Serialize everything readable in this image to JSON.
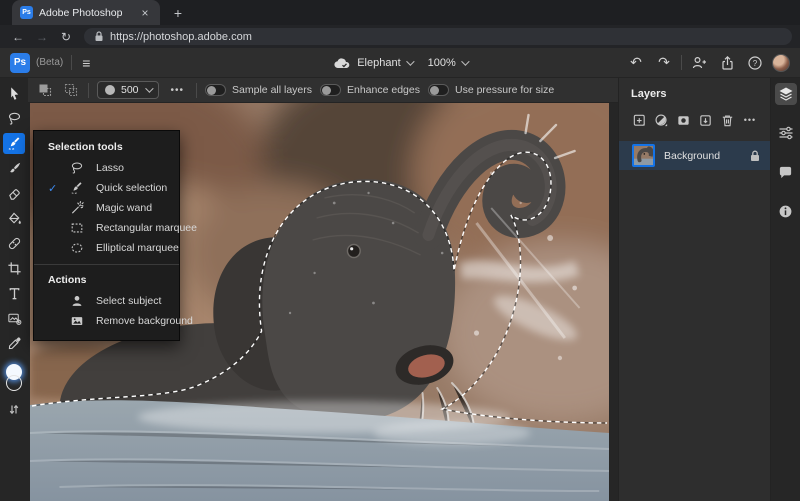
{
  "browser": {
    "tab_title": "Adobe Photoshop",
    "url": "https://photoshop.adobe.com"
  },
  "icons": {
    "close": "×",
    "new_tab": "+",
    "back": "←",
    "forward": "→",
    "reload": "↻",
    "hamburger": "≡",
    "undo": "↶",
    "redo": "↷",
    "help": "?",
    "check": "✓",
    "more_dots": "•••",
    "logo": "Ps",
    "favicon": "Ps"
  },
  "header": {
    "beta_label": "(Beta)",
    "doc_name": "Elephant",
    "zoom_level": "100%"
  },
  "options": {
    "brush_size": "500",
    "toggles": [
      {
        "label": "Sample all layers",
        "state": "off"
      },
      {
        "label": "Enhance edges",
        "state": "off"
      },
      {
        "label": "Use pressure for size",
        "state": "off"
      }
    ]
  },
  "toolbar": {
    "tools": [
      "move",
      "lasso",
      "quick-selection",
      "brush",
      "eraser",
      "fill-bucket",
      "healing-brush",
      "crop",
      "type",
      "image-adjust",
      "eyedropper"
    ],
    "active_tool": "quick-selection"
  },
  "menu": {
    "sections": [
      {
        "title": "Selection tools",
        "items": [
          {
            "label": "Lasso",
            "icon": "lasso-icon",
            "checked": false
          },
          {
            "label": "Quick selection",
            "icon": "quick-selection-icon",
            "checked": true
          },
          {
            "label": "Magic wand",
            "icon": "magic-wand-icon",
            "checked": false
          },
          {
            "label": "Rectangular marquee",
            "icon": "rectangular-marquee-icon",
            "checked": false
          },
          {
            "label": "Elliptical marquee",
            "icon": "elliptical-marquee-icon",
            "checked": false
          }
        ]
      },
      {
        "title": "Actions",
        "items": [
          {
            "label": "Select subject",
            "icon": "select-subject-icon",
            "checked": false
          },
          {
            "label": "Remove background",
            "icon": "remove-background-icon",
            "checked": false
          }
        ]
      }
    ]
  },
  "layers": {
    "title": "Layers",
    "rows": [
      {
        "name": "Background",
        "locked": true,
        "selected": true
      }
    ]
  },
  "colors": {
    "accent_blue": "#1473e6",
    "logo_blue": "#2b7de9",
    "selected_layer_row": "#2c3b4c",
    "panel_bg": "#2e2e2e",
    "menu_bg": "#1d1d1d"
  }
}
